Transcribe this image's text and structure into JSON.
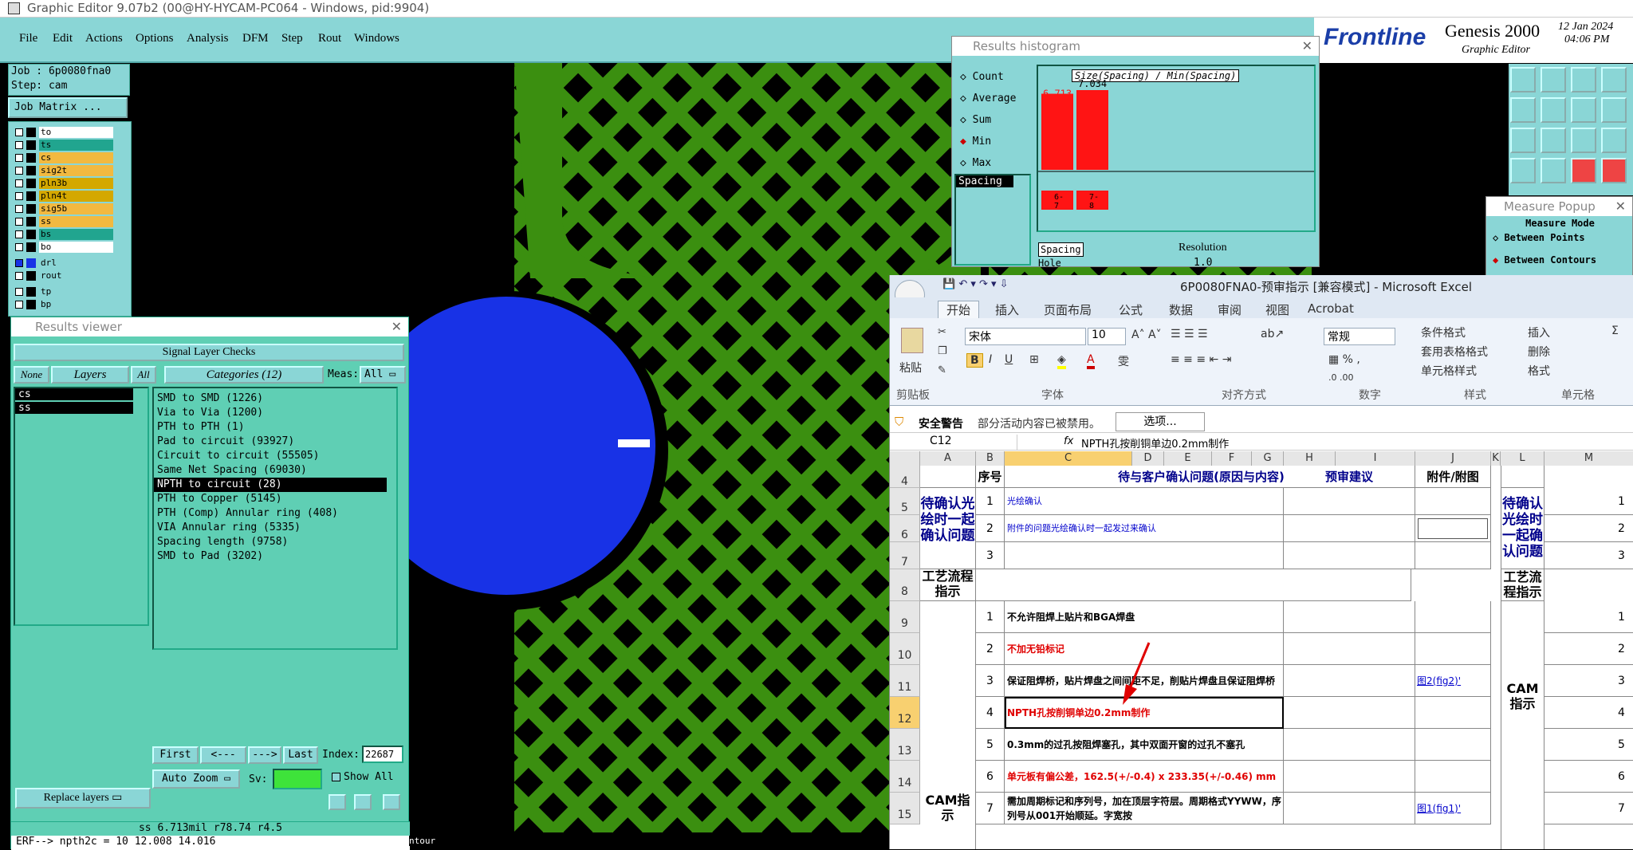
{
  "window": {
    "title": "Graphic Editor 9.07b2 (00@HY-HYCAM-PC064 - Windows, pid:9904)"
  },
  "menu": [
    "File",
    "Edit",
    "Actions",
    "Options",
    "Analysis",
    "DFM",
    "Step",
    "Rout",
    "Windows"
  ],
  "brand": {
    "logo": "Frontline",
    "product": "Genesis 2000",
    "subtitle": "Graphic Editor",
    "date": "12 Jan 2024",
    "time": "04:06 PM"
  },
  "job": {
    "job": "Job : 6p0080fna0",
    "step": "Step: cam",
    "matrix_btn": "Job Matrix ..."
  },
  "layers": [
    {
      "name": "to",
      "color": "#ffffff"
    },
    {
      "name": "ts",
      "color": "#21a58f"
    },
    {
      "name": "cs",
      "color": "#f2b940"
    },
    {
      "name": "sig2t",
      "color": "#f2b940"
    },
    {
      "name": "pln3b",
      "color": "#d4a800"
    },
    {
      "name": "pln4t",
      "color": "#d4a800"
    },
    {
      "name": "sig5b",
      "color": "#f2b940"
    },
    {
      "name": "ss",
      "color": "#f2b940"
    },
    {
      "name": "bs",
      "color": "#21a58f"
    },
    {
      "name": "bo",
      "color": "#ffffff"
    },
    {
      "name": "drl",
      "color": "#8ad6d6"
    },
    {
      "name": "rout",
      "color": "#8ad6d6"
    },
    {
      "name": "tp",
      "color": "#8ad6d6"
    },
    {
      "name": "bp",
      "color": "#8ad6d6"
    }
  ],
  "results_viewer": {
    "title": "Results viewer",
    "header": "Signal Layer Checks",
    "none_btn": "None",
    "layers_btn": "Layers",
    "all_btn": "All",
    "categories_btn": "Categories (12)",
    "meas_label": "Meas:",
    "meas_value": "All",
    "layers": [
      "cs",
      "ss"
    ],
    "categories": [
      "SMD to SMD (1226)",
      "Via to Via (1200)",
      "PTH to PTH (1)",
      "Pad to circuit (93927)",
      "Circuit to circuit (55505)",
      "Same Net Spacing (69030)",
      "NPTH to circuit (28)",
      "PTH to Copper (5145)",
      "PTH (Comp) Annular ring (408)",
      "VIA Annular ring (5335)",
      "Spacing length (9758)",
      "SMD to Pad (3202)"
    ],
    "selected_index": 6,
    "nav": {
      "first": "First",
      "prev": "<---",
      "next": "--->",
      "last": "Last",
      "index_label": "Index:",
      "index_value": "22687"
    },
    "zoom": "Auto Zoom",
    "sv": "Sv:",
    "show_all": "Show All",
    "status": "ss 6.713mil  r78.74  r4.5",
    "erf": "ERF--> npth2c = 10 12.008 14.016",
    "contour": "ntour"
  },
  "histogram": {
    "title": "Results histogram",
    "options": [
      "Count",
      "Average",
      "Sum",
      "Min",
      "Max"
    ],
    "selected_option": "Min",
    "list_item": "Spacing",
    "header": "Size(Spacing) / Min(Spacing)",
    "bars": [
      {
        "label": "6.713",
        "range": "6-\n7",
        "value": 6.713
      },
      {
        "label": "7.034",
        "range": "7-\n8",
        "value": 7.034
      }
    ],
    "row1": "Spacing",
    "row2": "Hole",
    "resolution_label": "Resolution",
    "resolution_value": "1.0"
  },
  "measure": {
    "title": "Measure Popup",
    "mode": "Measure Mode",
    "opt1": "Between Points",
    "opt2": "Between Contours"
  },
  "excel": {
    "title": "6P0080FNA0-预审指示 [兼容模式] - Microsoft Excel",
    "tabs": [
      "开始",
      "插入",
      "页面布局",
      "公式",
      "数据",
      "审阅",
      "视图",
      "Acrobat"
    ],
    "font": "宋体",
    "size": "10",
    "number_format": "常规",
    "paste": "粘贴",
    "groups": [
      "剪贴板",
      "字体",
      "对齐方式",
      "数字",
      "样式",
      "单元格"
    ],
    "styles": [
      "条件格式",
      "套用表格格式",
      "单元格样式"
    ],
    "cells": [
      "插入",
      "删除",
      "格式"
    ],
    "security_label": "安全警告",
    "security_msg": "部分活动内容已被禁用。",
    "options_btn": "选项...",
    "namebox": "C12",
    "formula": "NPTH孔按削铜单边0.2mm制作",
    "columns": [
      "A",
      "B",
      "C",
      "D",
      "E",
      "F",
      "G",
      "H",
      "I",
      "J",
      "K",
      "L",
      "M"
    ],
    "header_row": {
      "b": "序号",
      "c": "待与客户确认问题(原因与内容)",
      "h": "预审建议",
      "j": "附件/附图"
    },
    "section1": "待确认光绘时一起确认问题",
    "section2": "工艺流程指示",
    "section3": "CAM指示",
    "rows": [
      {
        "row": "5",
        "no": "1",
        "text": "光绘确认",
        "color": "#0000cc",
        "link": ""
      },
      {
        "row": "6",
        "no": "2",
        "text": "附件的问题光绘确认时一起发过来确认",
        "color": "#0000cc",
        "link": ""
      },
      {
        "row": "7",
        "no": "3",
        "text": "",
        "color": "#000",
        "link": ""
      },
      {
        "row": "9",
        "no": "1",
        "text": "不允许阻焊上贴片和BGA焊盘",
        "color": "#000",
        "link": ""
      },
      {
        "row": "10",
        "no": "2",
        "text": "不加无铅标记",
        "color": "#e00000",
        "link": ""
      },
      {
        "row": "11",
        "no": "3",
        "text": "保证阻焊桥，贴片焊盘之间间距不足，削贴片焊盘且保证阻焊桥",
        "color": "#000",
        "link": "图2(fig2)'"
      },
      {
        "row": "12",
        "no": "4",
        "text": "NPTH孔按削铜单边0.2mm制作",
        "color": "#e00000",
        "link": ""
      },
      {
        "row": "13",
        "no": "5",
        "text": "0.3mm的过孔按阻焊塞孔，其中双面开窗的过孔不塞孔",
        "color": "#000",
        "link": ""
      },
      {
        "row": "14",
        "no": "6",
        "text": "单元板有偏公差，162.5(+/-0.4) x 233.35(+/-0.46) mm",
        "color": "#e00000",
        "link": ""
      },
      {
        "row": "15",
        "no": "7",
        "text": "需加周期标记和序列号，加在顶层字符层。周期格式YYWW，序列号从001开始顺延。字宽按",
        "color": "#000",
        "link": "图1(fig1)'"
      }
    ],
    "row4": "4",
    "row8": "8",
    "right_nums": [
      "1",
      "2",
      "3",
      "1",
      "2",
      "3",
      "4",
      "5",
      "6",
      "7"
    ]
  }
}
